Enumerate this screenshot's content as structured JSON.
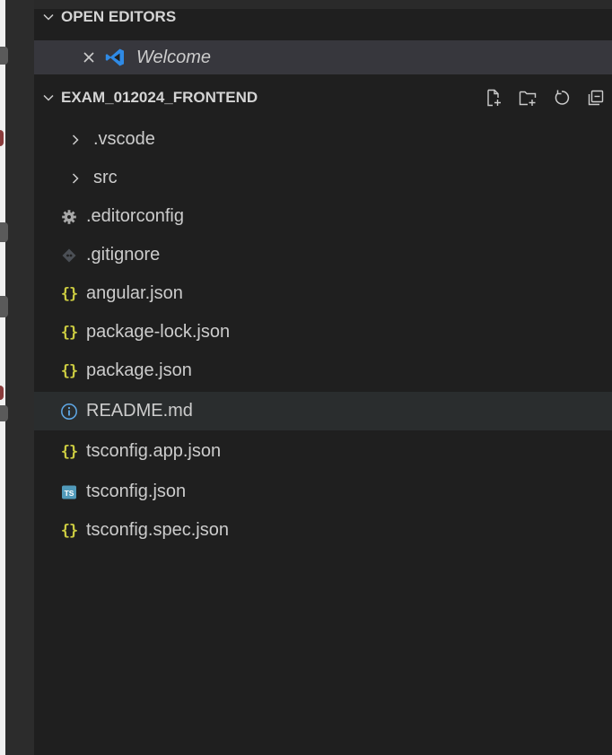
{
  "open_editors": {
    "title": "OPEN EDITORS",
    "items": [
      {
        "label": "Welcome",
        "icon": "vscode-logo-icon"
      }
    ]
  },
  "workspace": {
    "title": "EXAM_012024_FRONTEND",
    "actions": [
      {
        "name": "new-file-icon"
      },
      {
        "name": "new-folder-icon"
      },
      {
        "name": "refresh-icon"
      },
      {
        "name": "collapse-all-icon"
      }
    ],
    "tree": [
      {
        "label": ".vscode",
        "kind": "folder"
      },
      {
        "label": "src",
        "kind": "folder"
      },
      {
        "label": ".editorconfig",
        "kind": "file",
        "icon": "gear-icon"
      },
      {
        "label": ".gitignore",
        "kind": "file",
        "icon": "git-diamond-icon"
      },
      {
        "label": "angular.json",
        "kind": "file",
        "icon": "json-braces-icon"
      },
      {
        "label": "package-lock.json",
        "kind": "file",
        "icon": "json-braces-icon"
      },
      {
        "label": "package.json",
        "kind": "file",
        "icon": "json-braces-icon"
      },
      {
        "label": "README.md",
        "kind": "file",
        "icon": "info-icon"
      },
      {
        "label": "tsconfig.app.json",
        "kind": "file",
        "icon": "json-braces-icon"
      },
      {
        "label": "tsconfig.json",
        "kind": "file",
        "icon": "typescript-icon"
      },
      {
        "label": "tsconfig.spec.json",
        "kind": "file",
        "icon": "json-braces-icon"
      }
    ]
  },
  "colors": {
    "json_icon": "#cbcb41",
    "vscode_blue": "#2f8ae5",
    "ts_blue": "#519aba",
    "hover_row": "#2a2d2e",
    "selected_row": "#37373d"
  }
}
